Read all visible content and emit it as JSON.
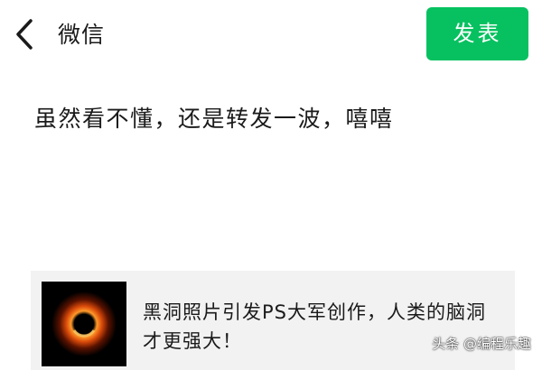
{
  "header": {
    "back_icon": "chevron-left-icon",
    "title": "微信",
    "publish_label": "发表",
    "publish_color": "#07c160"
  },
  "compose": {
    "text": "虽然看不懂，还是转发一波，嘻嘻"
  },
  "link_card": {
    "thumbnail_icon": "black-hole-image",
    "title": "黑洞照片引发PS大军创作，人类的脑洞才更强大！"
  },
  "watermark": {
    "text": "头条 @编程乐趣"
  }
}
